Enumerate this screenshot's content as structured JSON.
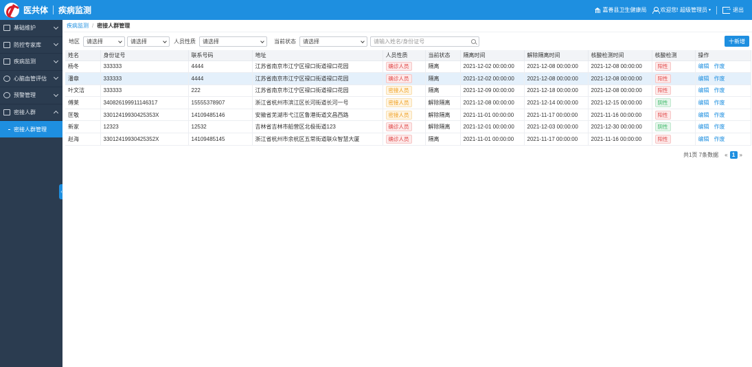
{
  "header": {
    "brand": "医共体",
    "system_name": "疾病监测",
    "org": "嘉善县卫生健康局",
    "welcome": "欢迎您! 超级管理员",
    "logout": "退出"
  },
  "sidebar": {
    "items": [
      {
        "label": "基础维护"
      },
      {
        "label": "防控专家库"
      },
      {
        "label": "疾病监测"
      },
      {
        "label": "心脑血管评估"
      },
      {
        "label": "预警管理"
      },
      {
        "label": "密接人群"
      }
    ],
    "sub_items": [
      {
        "label": "密接人群管理"
      }
    ]
  },
  "breadcrumb": {
    "parent": "疾病监测",
    "separator": "/",
    "current": "密接人群管理"
  },
  "filters": {
    "region_label": "地区",
    "region_select_1": "请选择",
    "region_select_2": "请选择",
    "person_type_label": "人员性质",
    "person_type_value": "请选择",
    "status_label": "当前状态",
    "status_value": "请选择",
    "search_placeholder": "请输入姓名/身份证号",
    "add_button": "十新增"
  },
  "table": {
    "headers": [
      "姓名",
      "身份证号",
      "联系号码",
      "地址",
      "人员性质",
      "当前状态",
      "隔离时间",
      "解除隔离时间",
      "核酸检测时间",
      "核酸检测",
      "操作"
    ],
    "rows": [
      {
        "name": "杨冬",
        "id": "333333",
        "phone": "4444",
        "address": "江苏省南京市江宁区禄口街道禄口花园",
        "type": "确诊人员",
        "type_color": "red",
        "status": "隔离",
        "iso_time": "2021-12-02 00:00:00",
        "release_time": "2021-12-08 00:00:00",
        "test_time": "2021-12-08 00:00:00",
        "result": "阳性",
        "result_color": "red",
        "edit": "编辑",
        "void": "作废"
      },
      {
        "name": "潘章",
        "id": "333333",
        "phone": "4444",
        "address": "江苏省南京市江宁区禄口街道禄口花园",
        "type": "确诊人员",
        "type_color": "red",
        "status": "隔离",
        "iso_time": "2021-12-02 00:00:00",
        "release_time": "2021-12-08 00:00:00",
        "test_time": "2021-12-08 00:00:00",
        "result": "阳性",
        "result_color": "red",
        "edit": "编辑",
        "void": "作废"
      },
      {
        "name": "叶文洁",
        "id": "333333",
        "phone": "222",
        "address": "江苏省南京市江宁区禄口街道禄口花园",
        "type": "密接人员",
        "type_color": "orange",
        "status": "隔离",
        "iso_time": "2021-12-09 00:00:00",
        "release_time": "2021-12-18 00:00:00",
        "test_time": "2021-12-08 00:00:00",
        "result": "阳性",
        "result_color": "red",
        "edit": "编辑",
        "void": "作废"
      },
      {
        "name": "傅莱",
        "id": "340826199911146317",
        "phone": "15555378907",
        "address": "浙江省杭州市滨江区长河街道长河一号",
        "type": "密接人员",
        "type_color": "orange",
        "status": "解除隔离",
        "iso_time": "2021-12-08 00:00:00",
        "release_time": "2021-12-14 00:00:00",
        "test_time": "2021-12-15 00:00:00",
        "result": "阴性",
        "result_color": "green",
        "edit": "编辑",
        "void": "作废"
      },
      {
        "name": "匡敬",
        "id": "33012419930425353X",
        "phone": "14109485146",
        "address": "安徽省芜湖市弋江区鲁港街道文昌西路",
        "type": "密接人员",
        "type_color": "orange",
        "status": "解除隔离",
        "iso_time": "2021-11-01 00:00:00",
        "release_time": "2021-11-17 00:00:00",
        "test_time": "2021-11-16 00:00:00",
        "result": "阳性",
        "result_color": "red",
        "edit": "编辑",
        "void": "作废"
      },
      {
        "name": "新家",
        "id": "12323",
        "phone": "12532",
        "address": "吉林省吉林市船营区北极街道123",
        "type": "确诊人员",
        "type_color": "red",
        "status": "解除隔离",
        "iso_time": "2021-12-01 00:00:00",
        "release_time": "2021-12-03 00:00:00",
        "test_time": "2021-12-30 00:00:00",
        "result": "阴性",
        "result_color": "green",
        "edit": "编辑",
        "void": "作废"
      },
      {
        "name": "赵海",
        "id": "33012419930425352X",
        "phone": "14109485145",
        "address": "浙江省杭州市余杭区五常街道联众智慧大厦",
        "type": "确诊人员",
        "type_color": "red",
        "status": "隔离",
        "iso_time": "2021-11-01 00:00:00",
        "release_time": "2021-11-17 00:00:00",
        "test_time": "2021-11-16 00:00:00",
        "result": "阳性",
        "result_color": "red",
        "edit": "编辑",
        "void": "作废"
      }
    ]
  },
  "pagination": {
    "summary": "共1页 7条数据",
    "prev": "«",
    "current": "1",
    "next": "»"
  },
  "colors": {
    "primary": "#1e8fe0",
    "sidebar_bg": "#2b3c50",
    "danger": "#e04848",
    "warning": "#f0a020",
    "success": "#3cb867"
  }
}
